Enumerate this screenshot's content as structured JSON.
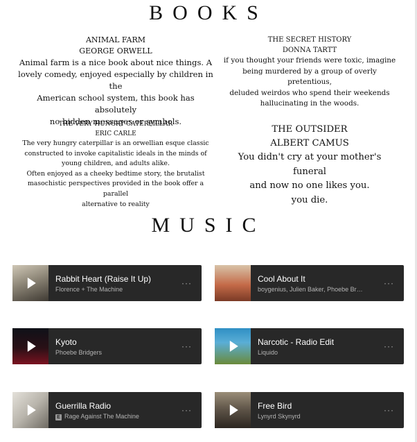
{
  "books_heading": "BOOKS",
  "music_heading": "MUSIC",
  "books": [
    {
      "title": "ANIMAL FARM",
      "author": "GEORGE ORWELL",
      "blurb": "Animal farm is a nice book about nice things. A\nlovely comedy, enjoyed especially by children in the\nAmerican school system, this book has absolutely\nno hidden messages or symbols."
    },
    {
      "title": "THE SECRET HISTORY",
      "author": "DONNA TARTT",
      "blurb": "if you thought your friends were toxic,  imagine\nbeing murdered by a group of overly pretentious,\ndeluded weirdos who spend their weekends\nhallucinating in the woods."
    },
    {
      "title": "THE VERY HUNGRY CATERPILLAR",
      "author": "ERIC CARLE",
      "blurb": "The very hungry caterpillar is an orwellian esque classic\nconstructed to invoke capitalistic ideals in the minds of\nyoung children, and adults alike.\nOften enjoyed as a cheeky bedtime story, the brutalist\nmasochistic perspectives provided in the book offer a parallel\nalternative to reality"
    },
    {
      "title": "THE OUTSIDER",
      "author": "ALBERT CAMUS",
      "blurb": "You didn't cry at your mother's funeral\nand now no one likes you.\nyou die."
    }
  ],
  "tracks": [
    {
      "name": "Rabbit Heart (Raise It Up)",
      "artist": "Florence + The Machine",
      "more": "···",
      "explicit": false
    },
    {
      "name": "Cool About It",
      "artist": "boygenius, Julien Baker, Phoebe Br…",
      "more": "···",
      "explicit": false
    },
    {
      "name": "Kyoto",
      "artist": "Phoebe Bridgers",
      "more": "···",
      "explicit": false
    },
    {
      "name": "Narcotic - Radio Edit",
      "artist": "Liquido",
      "more": "···",
      "explicit": false
    },
    {
      "name": "Guerrilla Radio",
      "artist": "Rage Against The Machine",
      "more": "···",
      "explicit": true,
      "explicit_label": "E"
    },
    {
      "name": "Free Bird",
      "artist": "Lynyrd Skynyrd",
      "more": "···",
      "explicit": false
    }
  ],
  "colors": {
    "page_bg": "#ffffff",
    "text": "#111111",
    "player_bg": "#282828",
    "player_subtext": "#b3b3b3"
  }
}
